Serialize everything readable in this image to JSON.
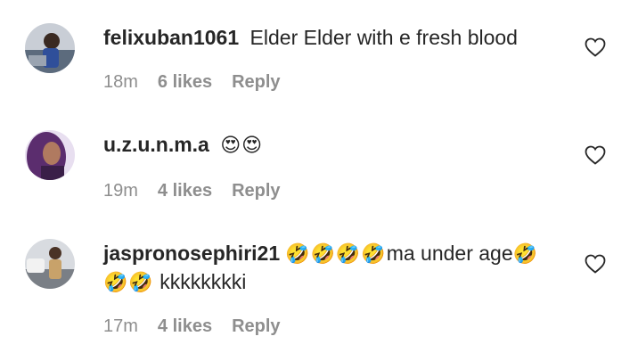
{
  "comments": [
    {
      "username": "felixuban1061",
      "text": "Elder Elder with e fresh blood",
      "emoji_before": "",
      "emoji_after": "",
      "line2": "",
      "time": "18m",
      "likes": "6 likes",
      "reply": "Reply",
      "avatar_color": "#7b8aa3"
    },
    {
      "username": "u.z.u.n.m.a",
      "text": "",
      "emoji_before": "😍😍",
      "emoji_after": "",
      "line2": "",
      "time": "19m",
      "likes": "4 likes",
      "reply": "Reply",
      "avatar_color": "#6a3f7a"
    },
    {
      "username": "jaspronosephiri21",
      "text": "ma under age",
      "emoji_before": "🤣🤣🤣🤣",
      "emoji_after": "🤣",
      "line2_emoji": "🤣🤣",
      "line2": "kkkkkkkki",
      "time": "17m",
      "likes": "4 likes",
      "reply": "Reply",
      "avatar_color": "#8b7d6b"
    }
  ],
  "colors": {
    "text": "#262626",
    "muted": "#8e8e8e",
    "background": "#ffffff"
  },
  "icons": {
    "like": "heart-outline-icon"
  }
}
